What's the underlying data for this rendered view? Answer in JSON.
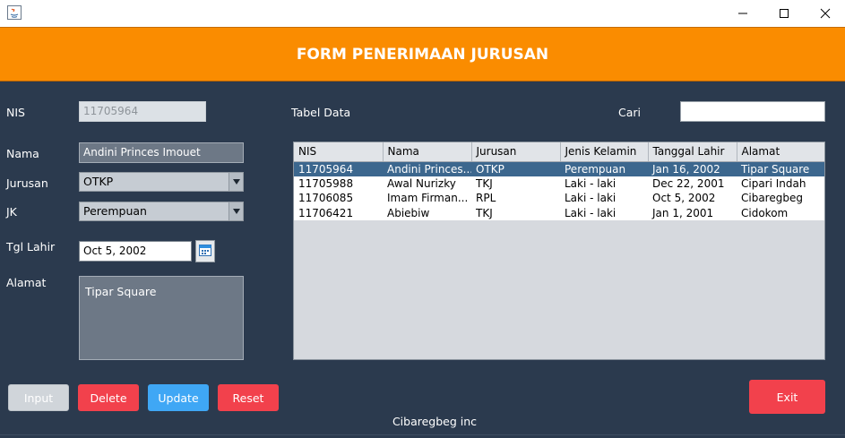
{
  "window": {
    "minimize_glyph": "—",
    "maximize_glyph": "☐",
    "close_glyph": "✕"
  },
  "header": {
    "title": "FORM PENERIMAAN JURUSAN"
  },
  "form": {
    "nis_label": "NIS",
    "nis_value": "11705964",
    "nama_label": "Nama",
    "nama_value": "Andini Princes Imouet",
    "jurusan_label": "Jurusan",
    "jurusan_value": "OTKP",
    "jk_label": "JK",
    "jk_value": "Perempuan",
    "tgl_label": "Tgl Lahir",
    "tgl_value": "Oct 5, 2002",
    "alamat_label": "Alamat",
    "alamat_value": "Tipar Square"
  },
  "table_section": {
    "title": "Tabel Data",
    "cari_label": "Cari",
    "cari_value": ""
  },
  "table": {
    "columns": [
      "NIS",
      "Nama",
      "Jurusan",
      "Jenis Kelamin",
      "Tanggal Lahir",
      "Alamat"
    ],
    "rows": [
      [
        "11705964",
        "Andini Princes...",
        "OTKP",
        "Perempuan",
        "Jan 16, 2002",
        "Tipar Square"
      ],
      [
        "11705988",
        "Awal Nurizky",
        "TKJ",
        "Laki - laki",
        "Dec 22, 2001",
        "Cipari Indah"
      ],
      [
        "11706085",
        "Imam Firman...",
        "RPL",
        "Laki - laki",
        "Oct 5, 2002",
        "Cibaregbeg"
      ],
      [
        "11706421",
        "Abiebiw",
        "TKJ",
        "Laki - laki",
        "Jan 1, 2001",
        "Cidokom"
      ]
    ]
  },
  "buttons": {
    "input": "Input",
    "delete": "Delete",
    "update": "Update",
    "reset": "Reset",
    "exit": "Exit"
  },
  "footer": {
    "text": "Cibaregbeg inc"
  },
  "colors": {
    "header": "#fa8c00",
    "panel": "#2b3a4e",
    "danger": "#f2414c",
    "primary": "#3fa7f5",
    "selected_row": "#3c678e"
  }
}
